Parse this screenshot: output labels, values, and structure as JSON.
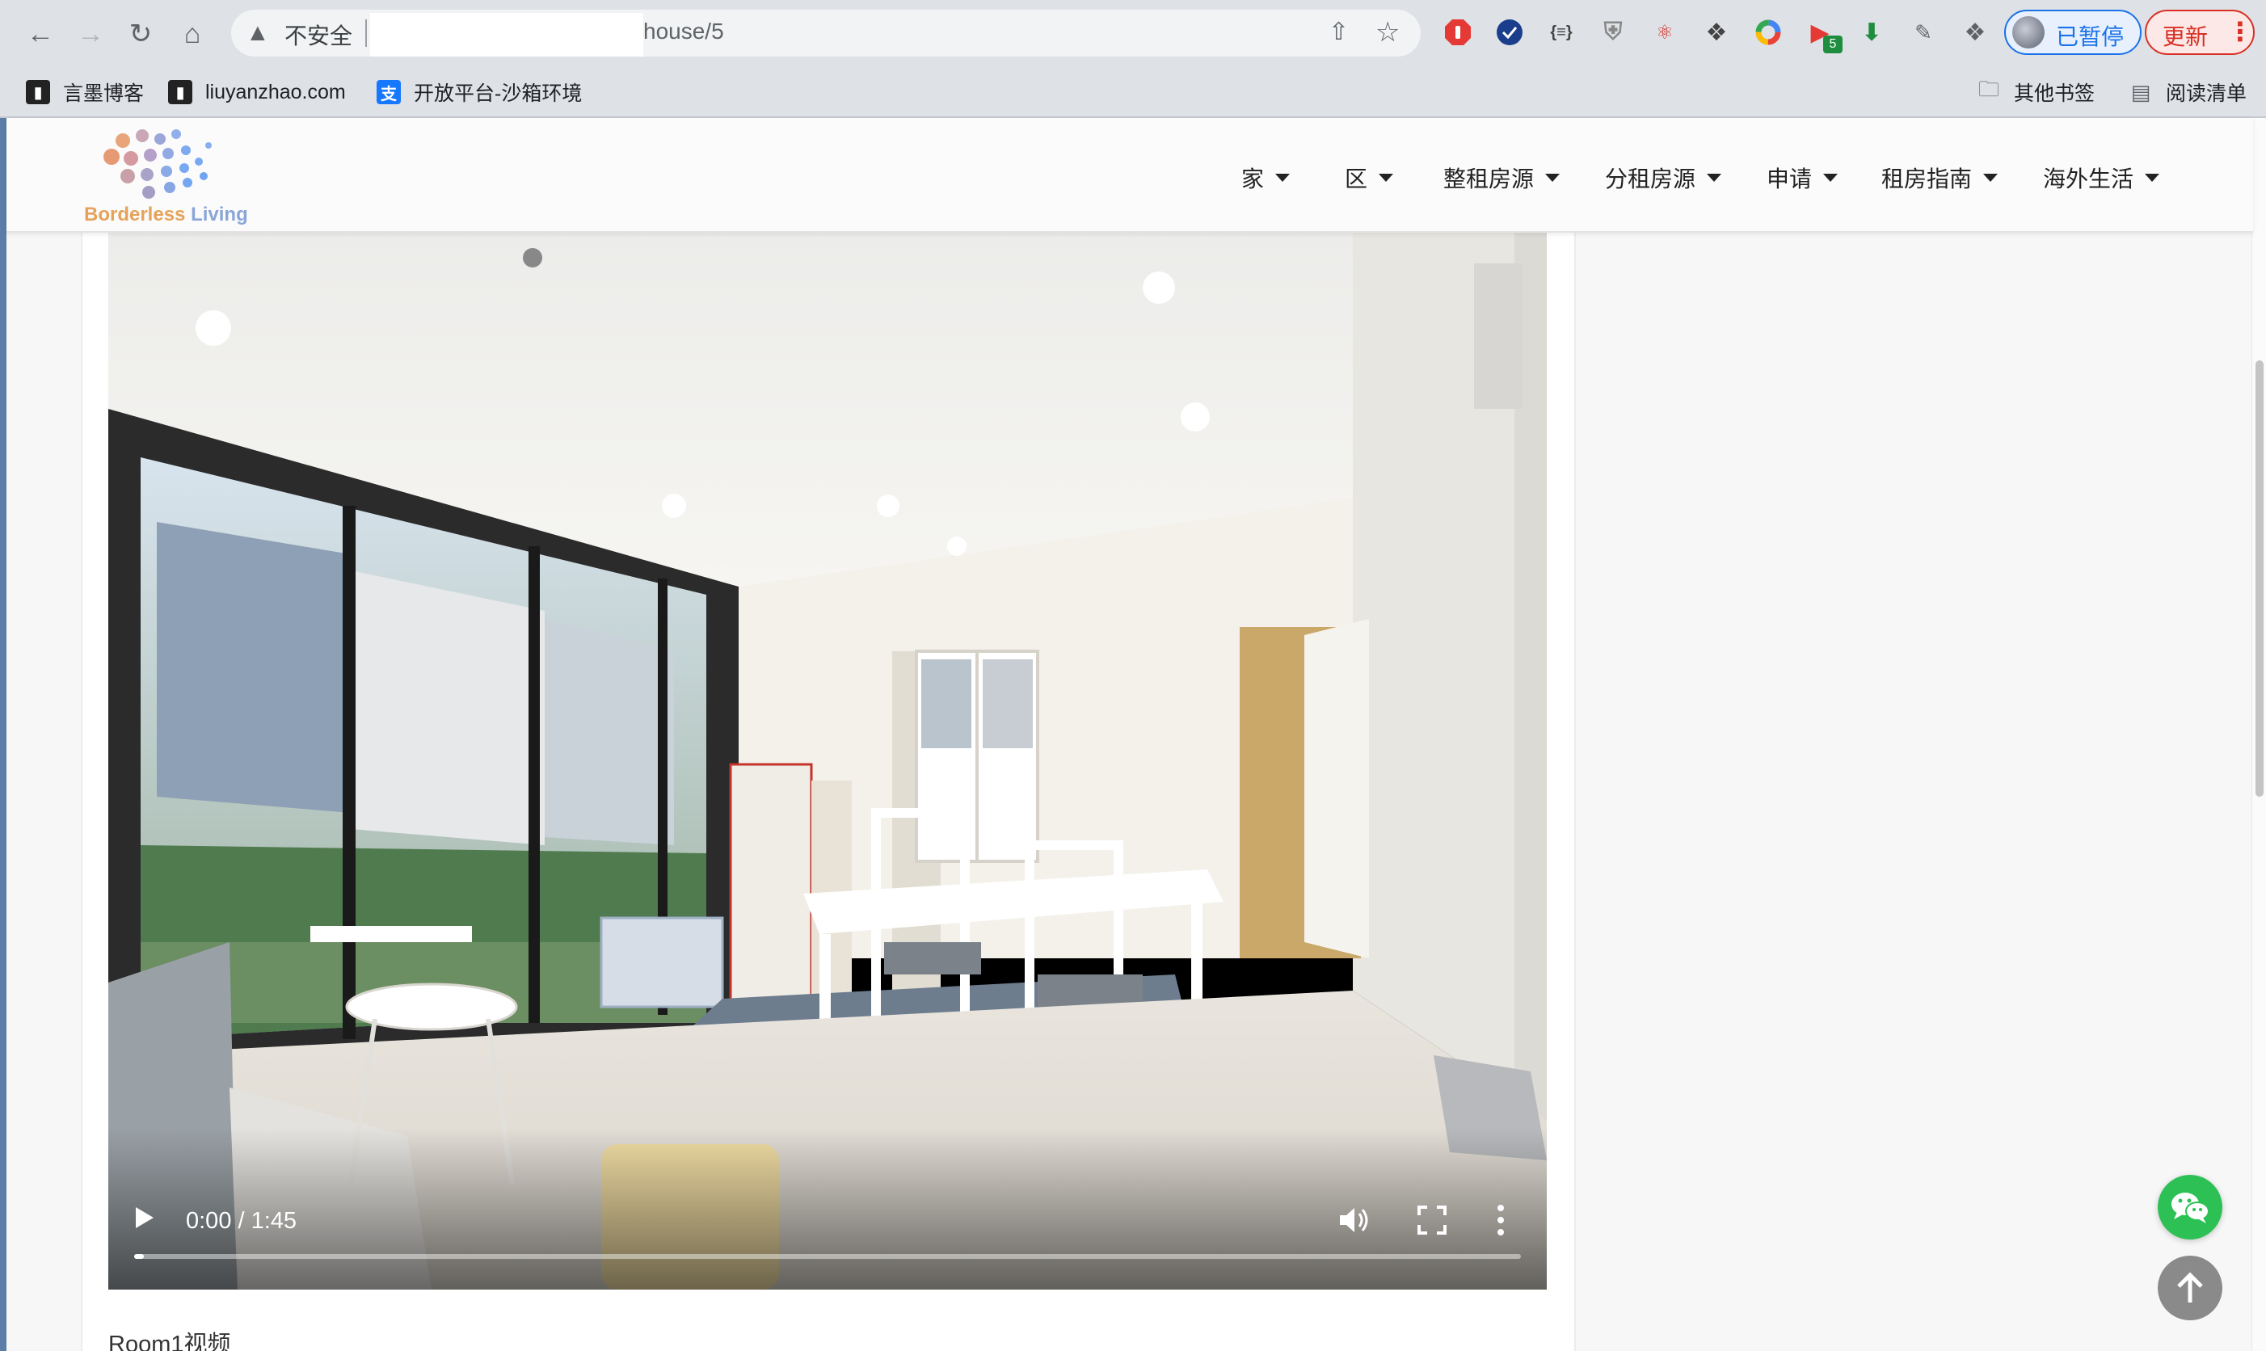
{
  "browser": {
    "security_label": "不安全",
    "url_visible": "house/5",
    "profile_status": "已暂停",
    "update_label": "更新",
    "extension_badge": "5"
  },
  "bookmarks": [
    {
      "label": "言墨博客",
      "icon": "blog-icon"
    },
    {
      "label": "liuyanzhao.com",
      "icon": "site-icon"
    },
    {
      "label": "开放平台-沙箱环境",
      "icon": "alipay-icon"
    }
  ],
  "bookmarks_right": [
    {
      "label": "其他书签",
      "icon": "folder-icon"
    },
    {
      "label": "阅读清单",
      "icon": "reading-list-icon"
    }
  ],
  "site": {
    "logo_text_a": "Borderless",
    "logo_text_b": "Living",
    "menu": [
      "家",
      "区",
      "整租房源",
      "分租房源",
      "申请",
      "租房指南",
      "海外生活"
    ]
  },
  "video": {
    "time": "0:00 / 1:45",
    "progress": 0.0
  },
  "caption": "Room1视频",
  "colors": {
    "wechat": "#2dc155",
    "update_red": "#d93025",
    "paused_blue": "#1a73e8"
  }
}
